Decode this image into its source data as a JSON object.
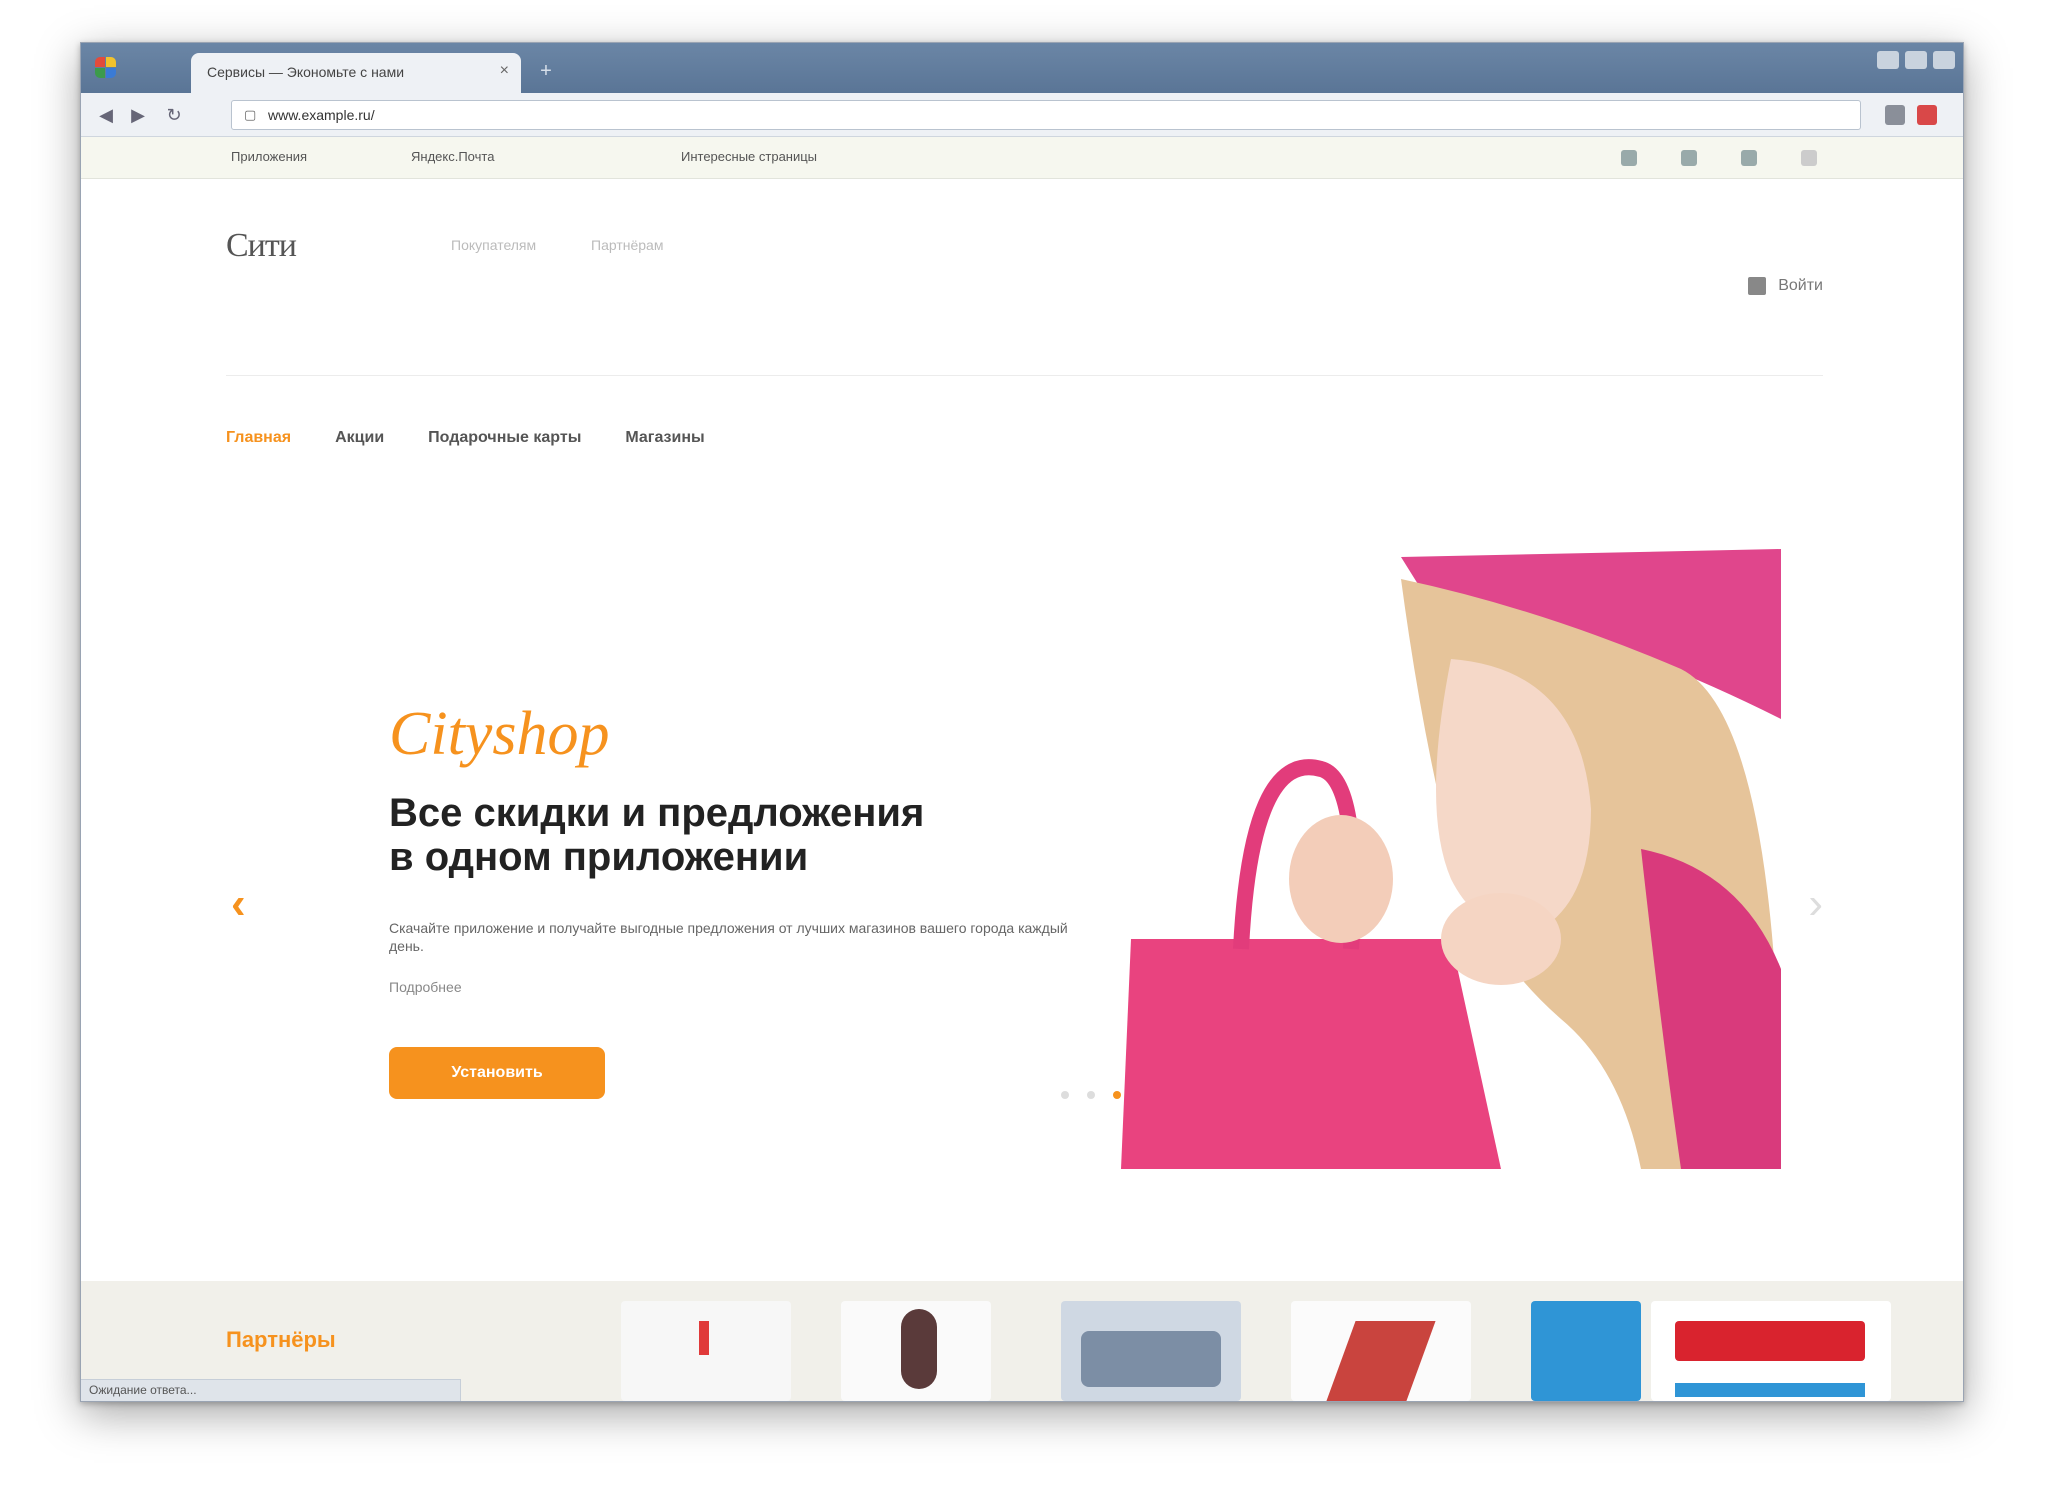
{
  "browser": {
    "tab_title": "Сервисы — Экономьте с нами",
    "tab_close": "×",
    "new_tab": "+",
    "back": "◀",
    "forward": "▶",
    "reload": "↻",
    "address": "www.example.ru/",
    "bookmarks": [
      "Приложения",
      "Яндекс.Почта",
      "Интересные страницы"
    ],
    "status": "Ожидание ответа..."
  },
  "site": {
    "logo": "Сити",
    "header_links": [
      "Покупателям",
      "Партнёрам"
    ],
    "login_label": "Войти",
    "menu": [
      {
        "label": "Главная",
        "active": true
      },
      {
        "label": "Акции"
      },
      {
        "label": "Подарочные карты"
      },
      {
        "label": "Магазины"
      }
    ],
    "hero": {
      "brand": "Cityshop",
      "title": "Все скидки и предложения в одном приложении",
      "text": "Скачайте приложение и получайте выгодные предложения от лучших магазинов вашего города каждый день.",
      "more": "Подробнее",
      "cta": "Установить",
      "prev_arrow": "‹",
      "next_arrow": "›"
    },
    "partners": {
      "label": "Партнёры"
    }
  },
  "colors": {
    "accent": "#f6921e",
    "titlebar": "#5a7596",
    "partners_bg": "#f1f0ea",
    "hero_pink": "#e23c7b"
  }
}
